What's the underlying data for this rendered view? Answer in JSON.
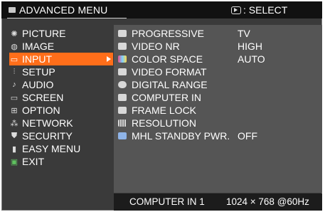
{
  "header": {
    "title": "ADVANCED MENU",
    "select_hint": "SELECT",
    "menu_icon": "menu-icon",
    "select_icon": "enter-button-icon"
  },
  "left_menu": {
    "items": [
      {
        "label": "PICTURE",
        "icon": "picture-icon"
      },
      {
        "label": "IMAGE",
        "icon": "image-icon"
      },
      {
        "label": "INPUT",
        "icon": "input-icon",
        "active": true
      },
      {
        "label": "SETUP",
        "icon": "setup-icon"
      },
      {
        "label": "AUDIO",
        "icon": "audio-icon"
      },
      {
        "label": "SCREEN",
        "icon": "screen-icon"
      },
      {
        "label": "OPTION",
        "icon": "option-icon"
      },
      {
        "label": "NETWORK",
        "icon": "network-icon"
      },
      {
        "label": "SECURITY",
        "icon": "security-icon"
      },
      {
        "label": "EASY MENU",
        "icon": "easy-menu-icon"
      },
      {
        "label": "EXIT",
        "icon": "exit-icon"
      }
    ]
  },
  "options": [
    {
      "label": "PROGRESSIVE",
      "value": "TV",
      "icon": "progressive-icon"
    },
    {
      "label": "VIDEO NR",
      "value": "HIGH",
      "icon": "video-nr-icon"
    },
    {
      "label": "COLOR SPACE",
      "value": "AUTO",
      "icon": "color-space-icon"
    },
    {
      "label": "VIDEO FORMAT",
      "value": "",
      "icon": "video-format-icon"
    },
    {
      "label": "DIGITAL RANGE",
      "value": "",
      "icon": "digital-range-icon"
    },
    {
      "label": "COMPUTER IN",
      "value": "",
      "icon": "computer-in-icon"
    },
    {
      "label": "FRAME LOCK",
      "value": "",
      "icon": "frame-lock-icon"
    },
    {
      "label": "RESOLUTION",
      "value": "",
      "icon": "resolution-icon"
    },
    {
      "label": "MHL STANDBY PWR.",
      "value": "OFF",
      "icon": "mhl-standby-icon"
    }
  ],
  "status": {
    "input": "COMPUTER IN 1",
    "signal": "1024 × 768 @60Hz"
  },
  "colors": {
    "accent": "#ff6e1a",
    "panel": "#555555",
    "background": "#3a3a3a",
    "header": "#111111"
  }
}
